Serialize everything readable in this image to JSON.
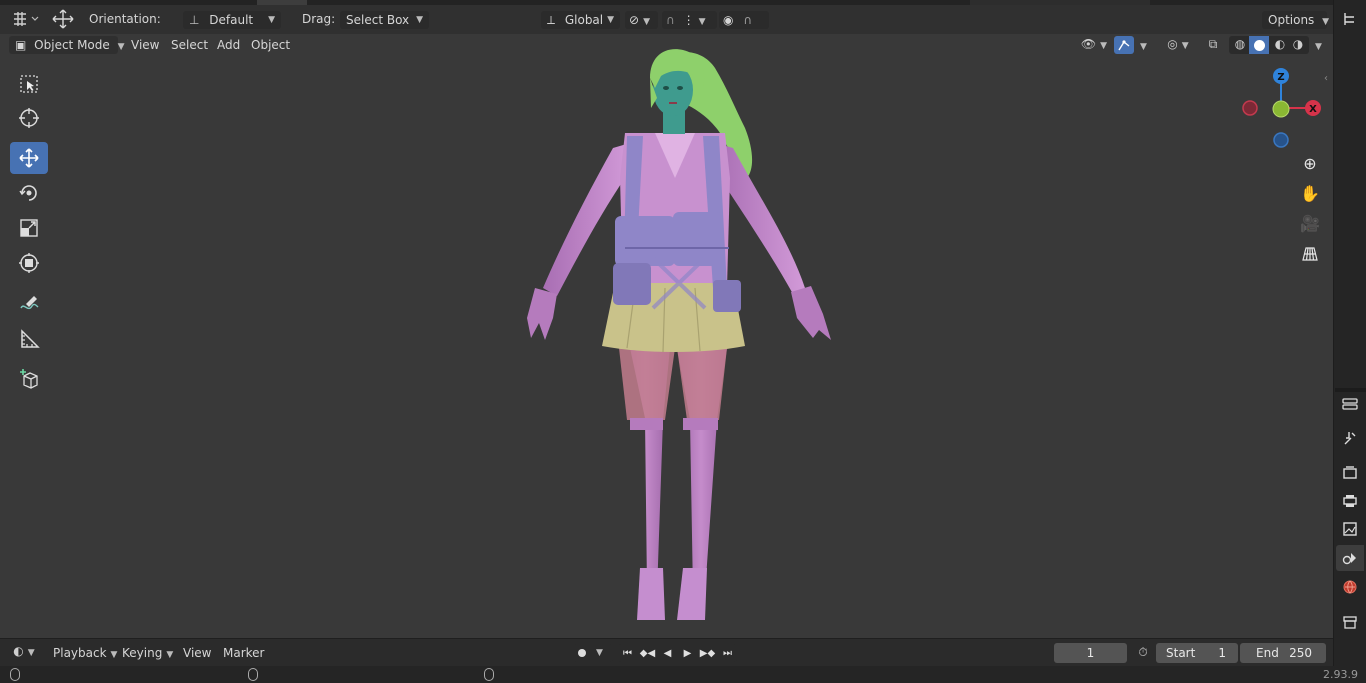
{
  "header": {
    "orientation_label": "Orientation:",
    "orientation_value": "Default",
    "drag_label": "Drag:",
    "drag_value": "Select Box",
    "transform_space": "Global",
    "options_label": "Options"
  },
  "viewport_header": {
    "mode": "Object Mode",
    "menus": [
      "View",
      "Select",
      "Add",
      "Object"
    ]
  },
  "toolbar": {
    "tools": [
      "select-box",
      "cursor",
      "move",
      "rotate",
      "scale",
      "transform",
      "annotate",
      "measure",
      "add-cube"
    ],
    "active_tool": "move"
  },
  "gizmo": {
    "z_label": "Z",
    "x_label": "X",
    "colors": {
      "x": "#d6334a",
      "y": "#8ab833",
      "z": "#2f83db"
    }
  },
  "timeline": {
    "menus": [
      "Playback",
      "Keying",
      "View",
      "Marker"
    ],
    "current_frame": "1",
    "start_label": "Start",
    "start_value": "1",
    "end_label": "End",
    "end_value": "250"
  },
  "status": {
    "version": "2.93.9"
  },
  "colors": {
    "accent": "#4772b3",
    "viewport_bg": "#393939",
    "skin": "#b57bbd",
    "skirt": "#c9c28a",
    "hair": "#8ed06b",
    "vest": "#8f86c8",
    "face": "#3f9b8e"
  }
}
